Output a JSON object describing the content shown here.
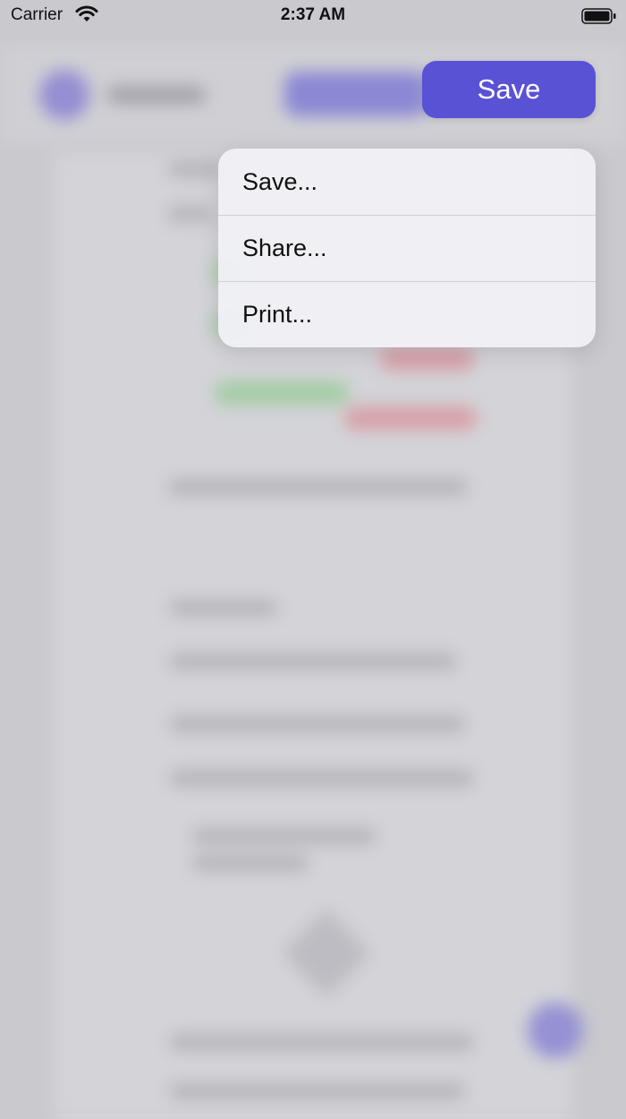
{
  "status_bar": {
    "carrier": "Carrier",
    "time": "2:37 AM",
    "wifi_icon": "wifi-icon",
    "battery_icon": "battery-icon"
  },
  "save_button": {
    "label": "Save",
    "color": "#5a52d5"
  },
  "menu": {
    "items": [
      {
        "label": "Save..."
      },
      {
        "label": "Share..."
      },
      {
        "label": "Print..."
      }
    ]
  }
}
